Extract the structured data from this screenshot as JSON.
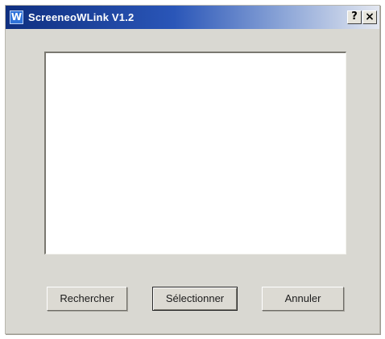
{
  "window": {
    "title": "ScreeneoWLink V1.2",
    "app_icon_letter": "W",
    "help_label": "?",
    "close_label": "×"
  },
  "list": {
    "items": []
  },
  "buttons": {
    "search_label": "Rechercher",
    "select_label": "Sélectionner",
    "cancel_label": "Annuler"
  },
  "colors": {
    "titlebar_start": "#0f2f80",
    "titlebar_end": "#e3e7f0",
    "dialog_face": "#d9d8d2"
  }
}
